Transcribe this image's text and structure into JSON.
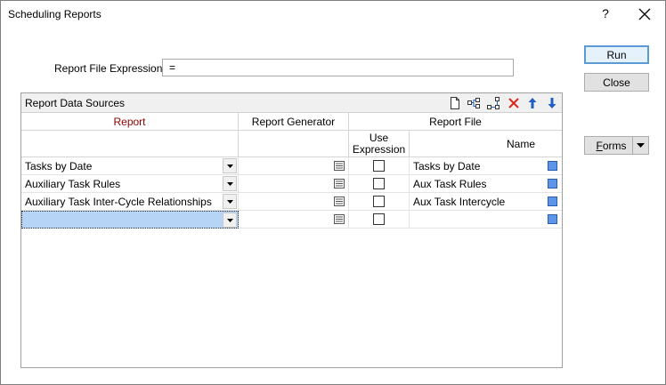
{
  "window": {
    "title": "Scheduling Reports",
    "help_label": "?"
  },
  "form": {
    "report_file_expression_label": "Report File Expression",
    "report_file_expression_value": "="
  },
  "buttons": {
    "run": "Run",
    "close": "Close",
    "forms_pre": "",
    "forms_accel": "F",
    "forms_post": "orms"
  },
  "grid": {
    "caption": "Report Data Sources",
    "columns": {
      "report": "Report",
      "report_generator": "Report Generator",
      "report_file": "Report File",
      "use_expression": "Use Expression",
      "name": "Name"
    },
    "rows": [
      {
        "report": "Tasks by Date",
        "use_expression": false,
        "name": "Tasks by Date"
      },
      {
        "report": "Auxiliary Task Rules",
        "use_expression": false,
        "name": "Aux Task Rules"
      },
      {
        "report": "Auxiliary Task Inter-Cycle Relationships",
        "use_expression": false,
        "name": "Aux Task Intercycle"
      },
      {
        "report": "",
        "use_expression": false,
        "name": ""
      }
    ],
    "toolbar_icons": [
      "new-document-icon",
      "add-row-icon",
      "insert-row-icon",
      "delete-icon",
      "move-up-icon",
      "move-down-icon"
    ]
  },
  "colors": {
    "accent_border": "#5b9bd5",
    "selected_row": "#b6d4f5",
    "report_header_text": "#8b0000",
    "delete_red": "#d9261c",
    "arrow_blue": "#1f5fbf"
  }
}
